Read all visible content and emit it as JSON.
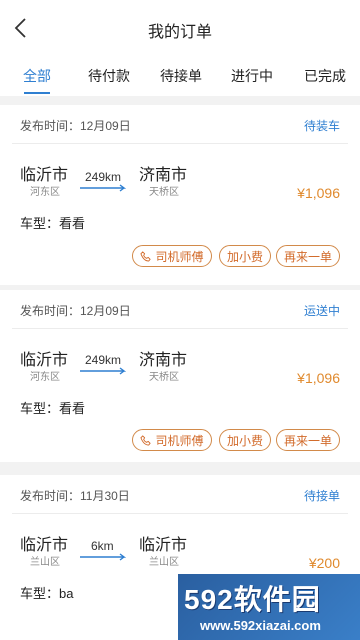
{
  "header": {
    "title": "我的订单"
  },
  "tabs": [
    {
      "label": "全部",
      "active": true
    },
    {
      "label": "待付款",
      "active": false
    },
    {
      "label": "待接单",
      "active": false
    },
    {
      "label": "进行中",
      "active": false
    },
    {
      "label": "已完成",
      "active": false
    }
  ],
  "colors": {
    "accent": "#2f7fd1",
    "price": "#e08a2e",
    "button": "#d26a2a"
  },
  "orders": [
    {
      "published": "发布时间：12月09日",
      "status": "待装车",
      "from_city": "临沂市",
      "from_district": "河东区",
      "distance": "249km",
      "to_city": "济南市",
      "to_district": "天桥区",
      "price": "¥1,096",
      "car_type": "车型：看看",
      "buttons": {
        "driver": "司机师傅",
        "tip": "加小费",
        "again": "再来一单"
      }
    },
    {
      "published": "发布时间：12月09日",
      "status": "运送中",
      "from_city": "临沂市",
      "from_district": "河东区",
      "distance": "249km",
      "to_city": "济南市",
      "to_district": "天桥区",
      "price": "¥1,096",
      "car_type": "车型：看看",
      "buttons": {
        "driver": "司机师傅",
        "tip": "加小费",
        "again": "再来一单"
      }
    },
    {
      "published": "发布时间：11月30日",
      "status": "待接单",
      "from_city": "临沂市",
      "from_district": "兰山区",
      "distance": "6km",
      "to_city": "临沂市",
      "to_district": "兰山区",
      "price": "¥200",
      "car_type": "车型：ba"
    }
  ],
  "watermark": {
    "brand": "592软件园",
    "url": "www.592xiazai.com"
  }
}
